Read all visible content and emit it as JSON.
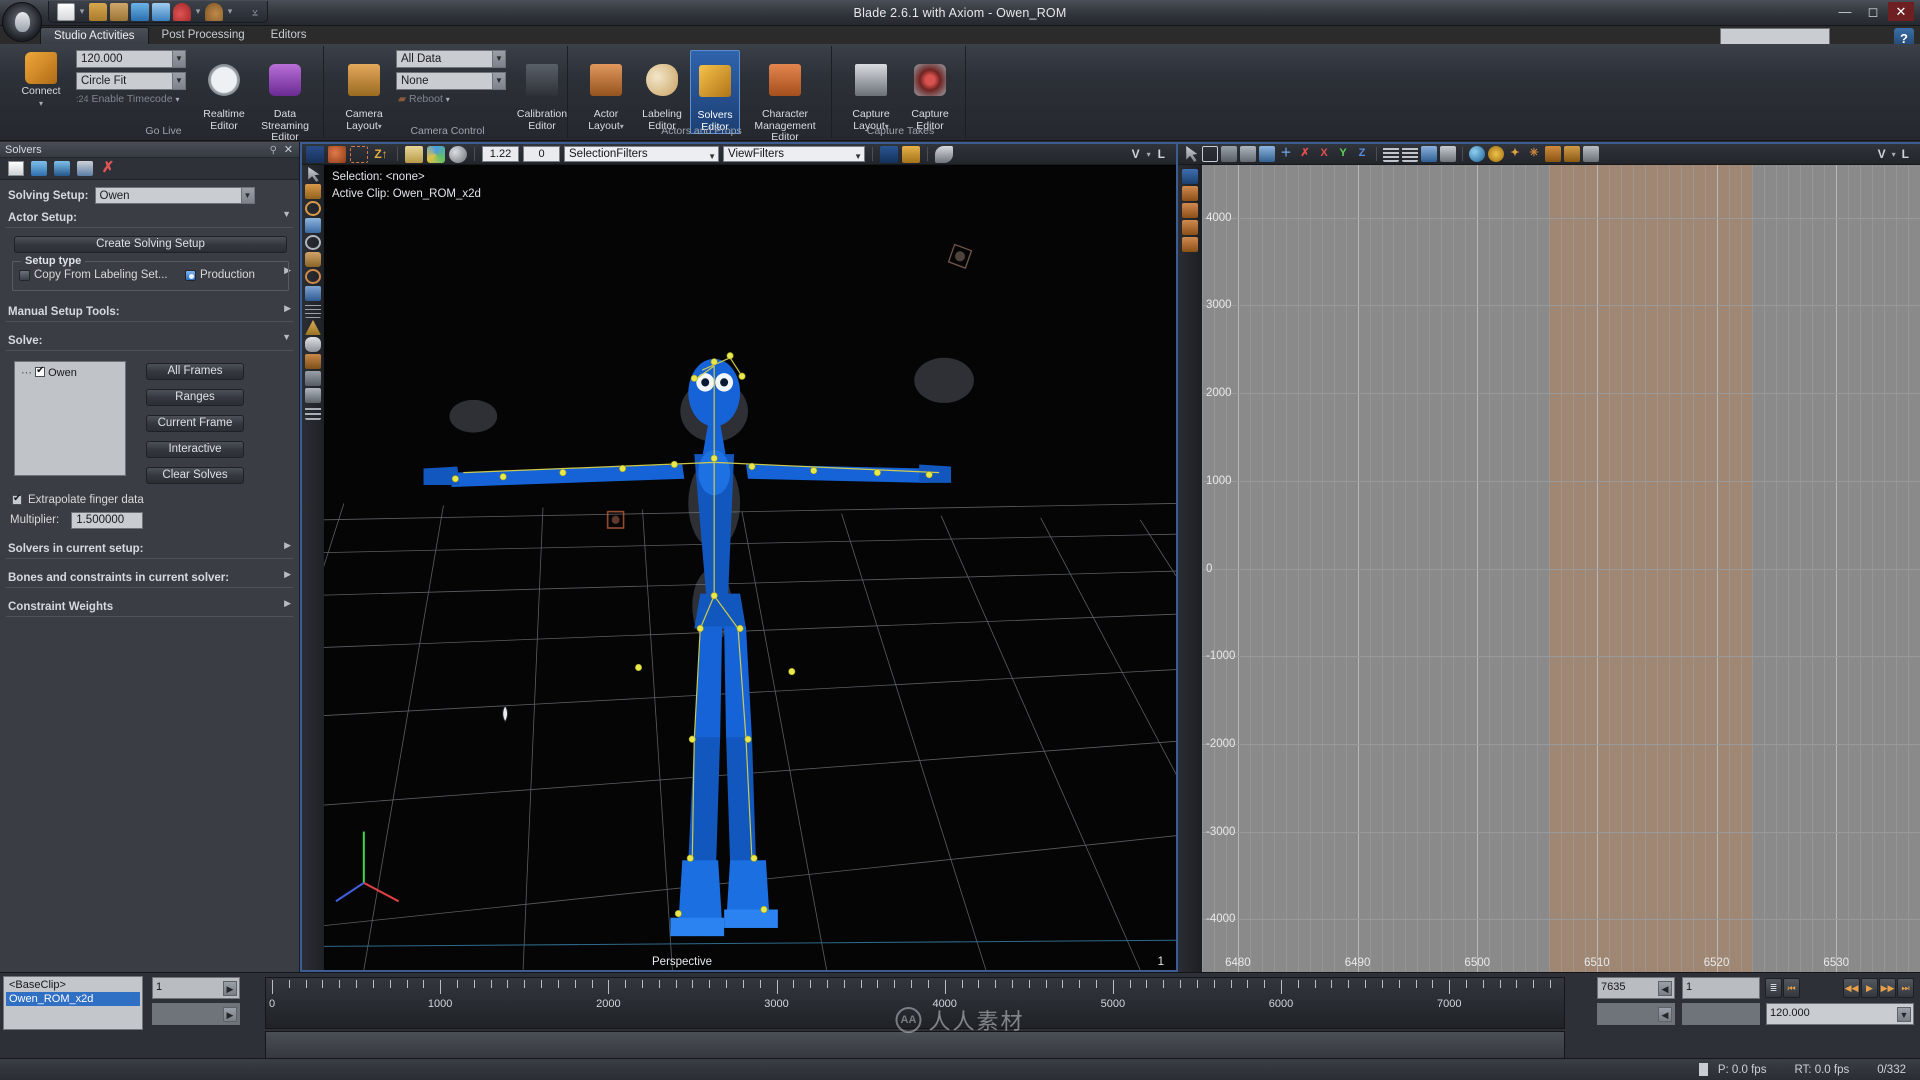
{
  "window": {
    "title": "Blade 2.6.1 with Axiom - Owen_ROM",
    "minimize": "—",
    "maximize": "◻",
    "close": "✕",
    "help": "?"
  },
  "quick_access": {
    "icons": [
      "new-document-icon",
      "caret-down-icon",
      "open-folder-icon",
      "save-icon",
      "import-icon",
      "export-icon",
      "undo-icon",
      "caret-down-icon",
      "redo-icon",
      "caret-down-icon",
      "customize-icon"
    ]
  },
  "ribbon": {
    "tabs": [
      {
        "label": "Studio Activities",
        "active": true
      },
      {
        "label": "Post Processing",
        "active": false
      },
      {
        "label": "Editors",
        "active": false
      }
    ],
    "groups": [
      {
        "name": "Go Live",
        "label": "Go Live",
        "connect_label": "Connect",
        "rate_value": "120.000",
        "fit_value": "Circle Fit",
        "timecode_label": "Enable Timecode",
        "realtime_editor": "Realtime\nEditor",
        "data_streaming_editor": "Data Streaming\nEditor"
      },
      {
        "name": "Camera Control",
        "label": "Camera Control",
        "camera_layout": "Camera\nLayout",
        "data_value": "All Data",
        "none_value": "None",
        "reboot_label": "Reboot",
        "calibration_editor": "Calibration\nEditor"
      },
      {
        "name": "Actors and Props",
        "label": "Actors and Props",
        "actor_layout": "Actor\nLayout",
        "labeling_editor": "Labeling\nEditor",
        "solvers_editor": "Solvers\nEditor",
        "character_management_editor": "Character\nManagement Editor"
      },
      {
        "name": "Capture Takes",
        "label": "Capture Takes",
        "capture_layout": "Capture\nLayout",
        "capture_editor": "Capture\nEditor"
      }
    ]
  },
  "solvers_panel": {
    "title": "Solvers",
    "toolbar_icons": [
      "new-solver-icon",
      "open-solver-icon",
      "import-solver-icon",
      "save-solver-icon",
      "delete-solver-icon"
    ],
    "solving_setup_label": "Solving Setup:",
    "solving_setup_value": "Owen",
    "actor_setup_label": "Actor Setup:",
    "create_solving_setup": "Create Solving Setup",
    "setup_type_legend": "Setup type",
    "setup_type_options": [
      {
        "label": "Copy From Labeling Set...",
        "selected": false
      },
      {
        "label": "Production",
        "selected": true
      }
    ],
    "manual_setup_tools": "Manual Setup Tools:",
    "solve_label": "Solve:",
    "solve_list": [
      {
        "label": "Owen",
        "checked": true
      }
    ],
    "solve_buttons": [
      "All Frames",
      "Ranges",
      "Current Frame",
      "Interactive",
      "Clear Solves"
    ],
    "extrapolate_label": "Extrapolate finger data",
    "extrapolate_checked": true,
    "multiplier_label": "Multiplier:",
    "multiplier_value": "1.500000",
    "solvers_in_setup": "Solvers in current setup:",
    "bones_constraints": "Bones and constraints in current solver:",
    "constraint_weights": "Constraint Weights"
  },
  "viewport": {
    "toolbar_icons": [
      "markers-icon",
      "marker-trace-icon",
      "marker-box-icon",
      "z-up-icon",
      "layers-icon",
      "color-icon",
      "sphere-icon"
    ],
    "num1": "1.22",
    "num2": "0",
    "selection_filters": "SelectionFilters",
    "view_filters": "ViewFilters",
    "icons_right": [
      "snap-icon",
      "lock-icon",
      "pick-icon"
    ],
    "v_label": "V",
    "l_label": "L",
    "sidebar_icons": [
      "select-arrow-icon",
      "move-icon",
      "rotate-icon",
      "scale-icon",
      "orbit-icon",
      "pan-icon",
      "zoom-icon",
      "measure-icon",
      "grid-icon",
      "ik-icon",
      "bone-icon",
      "curve-icon",
      "wave-icon",
      "graph-icon",
      "list-icon"
    ],
    "selection_text": "Selection: <none>",
    "active_clip_text": "Active Clip: Owen_ROM_x2d",
    "perspective_label": "Perspective",
    "frame_label": "1"
  },
  "graph_panel": {
    "toolbar_icons": [
      "arrow-icon",
      "box-icon",
      "curve-icon",
      "region-icon",
      "key-icon",
      "add-icon",
      "delete-x-icon",
      "axis-x-icon",
      "axis-y-icon",
      "axis-z-icon",
      "list1-icon",
      "list2-icon",
      "list3-icon",
      "grid-icon",
      "globe-icon",
      "sun-icon",
      "star-icon",
      "spark-icon",
      "flag-icon",
      "tag-icon",
      "chain-icon"
    ],
    "v_label": "V",
    "l_label": "L",
    "sidebar_icons": [
      "cursor-icon",
      "peak-curve-icon",
      "bell-curve-icon",
      "step-curve-icon",
      "square-curve-icon"
    ]
  },
  "chart_data": {
    "type": "line",
    "title": "",
    "xlabel": "",
    "ylabel": "",
    "x_ticks": [
      6480,
      6490,
      6500,
      6510,
      6520,
      6530
    ],
    "y_ticks": [
      4000,
      3000,
      2000,
      1000,
      0,
      -1000,
      -2000,
      -3000,
      -4000
    ],
    "xlim": [
      6477,
      6537
    ],
    "ylim": [
      -4600,
      4600
    ],
    "grid": true,
    "legend": "none",
    "series": [],
    "annotations": [
      {
        "type": "range-highlight",
        "x_start": 6506,
        "x_end": 6523,
        "color": "#b4825a"
      }
    ]
  },
  "timeline": {
    "clips": [
      {
        "label": "<BaseClip>",
        "selected": false
      },
      {
        "label": "Owen_ROM_x2d",
        "selected": true
      }
    ],
    "left_spin_top": "1",
    "left_spin_bottom": "",
    "ruler_ticks": [
      0,
      1000,
      2000,
      3000,
      4000,
      5000,
      6000,
      7000
    ],
    "right_spin_1": "7635",
    "right_spin_2": "1",
    "right_spin_3": "",
    "right_spin_4": "",
    "rate_value": "120.000",
    "transport_icons": [
      "skip-start-icon",
      "step-back-icon",
      "play-back-icon",
      "play-forward-icon",
      "step-forward-icon",
      "skip-end-icon"
    ]
  },
  "status_bar": {
    "play_fps": "P: 0.0 fps",
    "realtime_fps": "RT: 0.0 fps",
    "frame_counter": "0/332"
  },
  "watermark": {
    "mark": "AA",
    "text": "人人素材"
  },
  "colors": {
    "accent_blue": "#3c5d93",
    "selection_blue": "#2f6fc4",
    "ribbon_bg": "#2c3037",
    "panel_bg": "#3a3e44",
    "plot_bg": "#8a8a8a",
    "highlight_band": "#b4825a"
  }
}
